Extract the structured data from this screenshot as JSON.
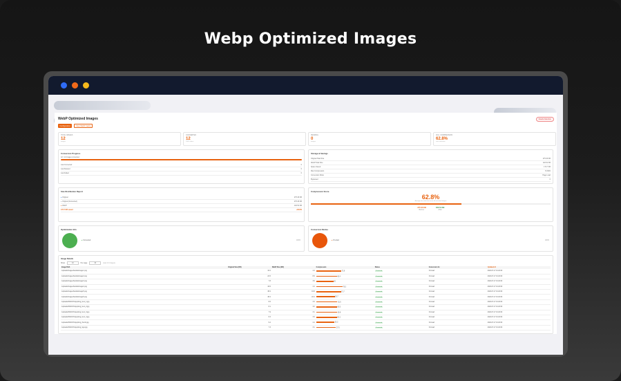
{
  "headline": "Webp Optimized Images",
  "colors": {
    "accent": "#e8620f",
    "green": "#4caf50",
    "titlebar": "#121a2e"
  },
  "window_dots": [
    {
      "name": "blue",
      "color": "#2f6cf6"
    },
    {
      "name": "orange",
      "color": "#f06a1a"
    },
    {
      "name": "yellow",
      "color": "#f5b91c"
    }
  ],
  "page": {
    "title": "WebP Optimized Images",
    "badge": "Needs Attention",
    "btn_primary": "Configuration",
    "btn_secondary": "Clear WebP Cache"
  },
  "stats": [
    {
      "label": "Total Images",
      "value": "12",
      "sub": "images"
    },
    {
      "label": "Converted",
      "value": "12",
      "sub": "100% done"
    },
    {
      "label": "Pending",
      "value": "0",
      "sub": "images"
    },
    {
      "label": "Avg. Compression",
      "value": "62.8%",
      "sub": "size reduction"
    }
  ],
  "conversion": {
    "title": "Conversion Progress",
    "summary": "12 / 12 images converted",
    "progress": 1.0,
    "rows": [
      [
        "Last Converted",
        "0"
      ],
      [
        "Last Deleted",
        "0"
      ],
      [
        "Last Failed",
        "0"
      ]
    ]
  },
  "storage": {
    "title": "Storage & Savings",
    "rows": [
      [
        "Original Total Size",
        "275.33 KB"
      ],
      [
        "WebP Total Size",
        "102.51 KB"
      ],
      [
        "Space Saved",
        "172.7 KB"
      ],
      [
        "Max Compression",
        "72.90%"
      ],
      [
        "Conversion Mode",
        "Page Load"
      ],
      [
        "Bypassed",
        "0"
      ]
    ]
  },
  "detection": {
    "title": "Size Distribution Report",
    "rows": [
      {
        "label": "Original",
        "value": "275.33 KB",
        "color": "#3b82f6"
      },
      {
        "label": "Original (Converted)",
        "value": "275.33 KB",
        "color": "#9ca3af"
      },
      {
        "label": "WebP",
        "value": "102.51 KB",
        "color": "#e8620f"
      },
      {
        "label": "172.7 KB saved",
        "value": "+62.8%",
        "color": "#e8620f"
      }
    ]
  },
  "score": {
    "title": "Compression Score",
    "value": "62.8%",
    "caption": "Average size reduction across all converted images",
    "fill": 0.628,
    "left_val": "-275.33 KB",
    "left_lbl": "Before",
    "right_val": "102.51 KB",
    "right_lbl": "After"
  },
  "optimization": {
    "title": "Optimization Info",
    "legend": "Converted",
    "right": "100%"
  },
  "conversion_mode": {
    "title": "Conversion Modes",
    "legend": "On-load",
    "right": "100%"
  },
  "table": {
    "title": "Image Details",
    "show_label": "Show",
    "show_value": "10",
    "perpage_label": "Per page",
    "perpage_value": "10",
    "count_text": "(Last 10 images)",
    "headers": [
      "Image Path",
      "Original Size (KB)",
      "WebP Size (KB)",
      "Compression",
      "Status",
      "Conversion At",
      "Updated At"
    ],
    "rows": [
      {
        "path": "/uploads/images/lovableImage1.png",
        "orig": "16.2",
        "webp": "4.4",
        "pct": 72.9,
        "status": "Converted",
        "mode": "On-load",
        "date": "2024-07-17 10:22:00"
      },
      {
        "path": "/uploads/images/lovableImage2.png",
        "orig": "22.5",
        "webp": "8.9",
        "pct": 60.4,
        "status": "Converted",
        "mode": "On-load",
        "date": "2024-07-17 10:22:00"
      },
      {
        "path": "/uploads/images/lovableImage3.png",
        "orig": "7.8",
        "webp": "3.9",
        "pct": 50.0,
        "status": "Converted",
        "mode": "On-load",
        "date": "2024-07-17 10:22:00"
      },
      {
        "path": "/uploads/images/lovableImage4.png",
        "orig": "18.6",
        "webp": "4.4",
        "pct": 76.3,
        "status": "Converted",
        "mode": "On-load",
        "date": "2024-07-17 10:22:00"
      },
      {
        "path": "/uploads/images/lovableImage5.png",
        "orig": "38.2",
        "webp": "10.8",
        "pct": 71.7,
        "status": "Converted",
        "mode": "On-load",
        "date": "2024-07-17 10:22:00"
      },
      {
        "path": "/uploads/images/lovableImage6.png",
        "orig": "48.4",
        "webp": "22.4",
        "pct": 53.7,
        "status": "Converted",
        "mode": "On-load",
        "date": "2024-07-17 10:22:00"
      },
      {
        "path": "/uploads/2024/07/wpoptimg_hero_1.jpg",
        "orig": "8.6",
        "webp": "3.3",
        "pct": 61.6,
        "status": "Converted",
        "mode": "On-load",
        "date": "2024-07-17 10:22:00"
      },
      {
        "path": "/uploads/2024/07/wpoptimg_hero_2.jpg",
        "orig": "8.1",
        "webp": "3.2",
        "pct": 60.5,
        "status": "Converted",
        "mode": "On-load",
        "date": "2024-07-17 10:22:00"
      },
      {
        "path": "/uploads/2024/07/wpoptimg_hero_3.jpg",
        "orig": "7.9",
        "webp": "3.1",
        "pct": 60.8,
        "status": "Converted",
        "mode": "On-load",
        "date": "2024-07-17 10:22:00"
      },
      {
        "path": "/uploads/2024/07/wpoptimg_hero_4.jpg",
        "orig": "8.3",
        "webp": "3.3",
        "pct": 60.2,
        "status": "Converted",
        "mode": "On-load",
        "date": "2024-07-17 10:22:00"
      },
      {
        "path": "/uploads/2024/07/wpoptimg_thumb.jpg",
        "orig": "9.4",
        "webp": "4.4",
        "pct": 53.2,
        "status": "Converted",
        "mode": "On-load",
        "date": "2024-07-17 10:22:00"
      },
      {
        "path": "/uploads/2024/07/wpoptimg_logo.jpg",
        "orig": "7.3",
        "webp": "3.1",
        "pct": 57.5,
        "status": "Converted",
        "mode": "On-load",
        "date": "2024-07-17 10:22:00"
      }
    ]
  }
}
